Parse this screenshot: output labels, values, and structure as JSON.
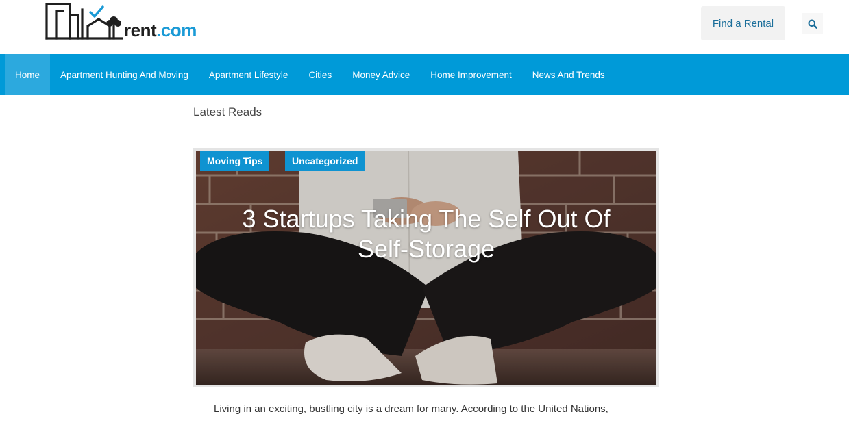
{
  "brand": {
    "logo_text_1": "rent",
    "logo_text_2": ".com"
  },
  "header": {
    "find_rental_label": "Find a Rental",
    "search_icon": "search-icon"
  },
  "nav": {
    "items": [
      {
        "label": "Home"
      },
      {
        "label": "Apartment Hunting And Moving"
      },
      {
        "label": "Apartment Lifestyle"
      },
      {
        "label": "Cities"
      },
      {
        "label": "Money Advice"
      },
      {
        "label": "Home Improvement"
      },
      {
        "label": "News And Trends"
      }
    ],
    "active": "Home"
  },
  "section": {
    "title": "Latest Reads"
  },
  "article": {
    "tags": [
      "Moving Tips",
      "Uncategorized"
    ],
    "title": "3 Startups Taking The Self Out Of Self-Storage",
    "excerpt": "Living in an exciting, bustling city is a dream for many. According to the United Nations,"
  },
  "colors": {
    "nav_bg": "#009ad8",
    "nav_active": "#2ca9de",
    "tag_bg": "#0f93d1",
    "brand_blue": "#1a9ad6"
  }
}
